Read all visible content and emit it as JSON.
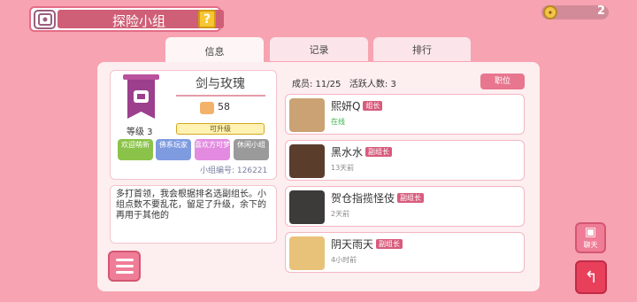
{
  "title": "探险小组",
  "help": "?",
  "currency": "2",
  "tabs": [
    "信息",
    "记录",
    "排行"
  ],
  "guild": {
    "name": "剑与玫瑰",
    "score": "58",
    "level": "等级 3",
    "upgrade": "可升级",
    "tags": [
      {
        "text": "欢迎萌新",
        "color": "#8bc34a"
      },
      {
        "text": "佛系玩家",
        "color": "#7e9be0"
      },
      {
        "text": "喜欢方可梦",
        "color": "#e28be0"
      },
      {
        "text": "休闲小组",
        "color": "#9a9a9a"
      }
    ],
    "number": "小组编号: 126221",
    "description": "多打首领，我会根据排名选副组长。小组点数不要乱花，留足了升级，余下的再用于其他的"
  },
  "members_header": {
    "members": "成员: 11/25",
    "active": "活跃人数: 3"
  },
  "role_button": "职位",
  "members": [
    {
      "name": "熙妍Q",
      "role": "组长",
      "status": "在线",
      "online": true,
      "avatar_color": "#caa273"
    },
    {
      "name": "黑水水",
      "role": "副组长",
      "status": "13天前",
      "online": false,
      "avatar_color": "#5b3d2c"
    },
    {
      "name": "贺仓指揽怪伎",
      "role": "副组长",
      "status": "2天前",
      "online": false,
      "avatar_color": "#3d3a3a"
    },
    {
      "name": "阴天雨天",
      "role": "副组长",
      "status": "4小时前",
      "online": false,
      "avatar_color": "#e9c27a"
    }
  ],
  "chat_label": "聊天",
  "back_label": "↰"
}
